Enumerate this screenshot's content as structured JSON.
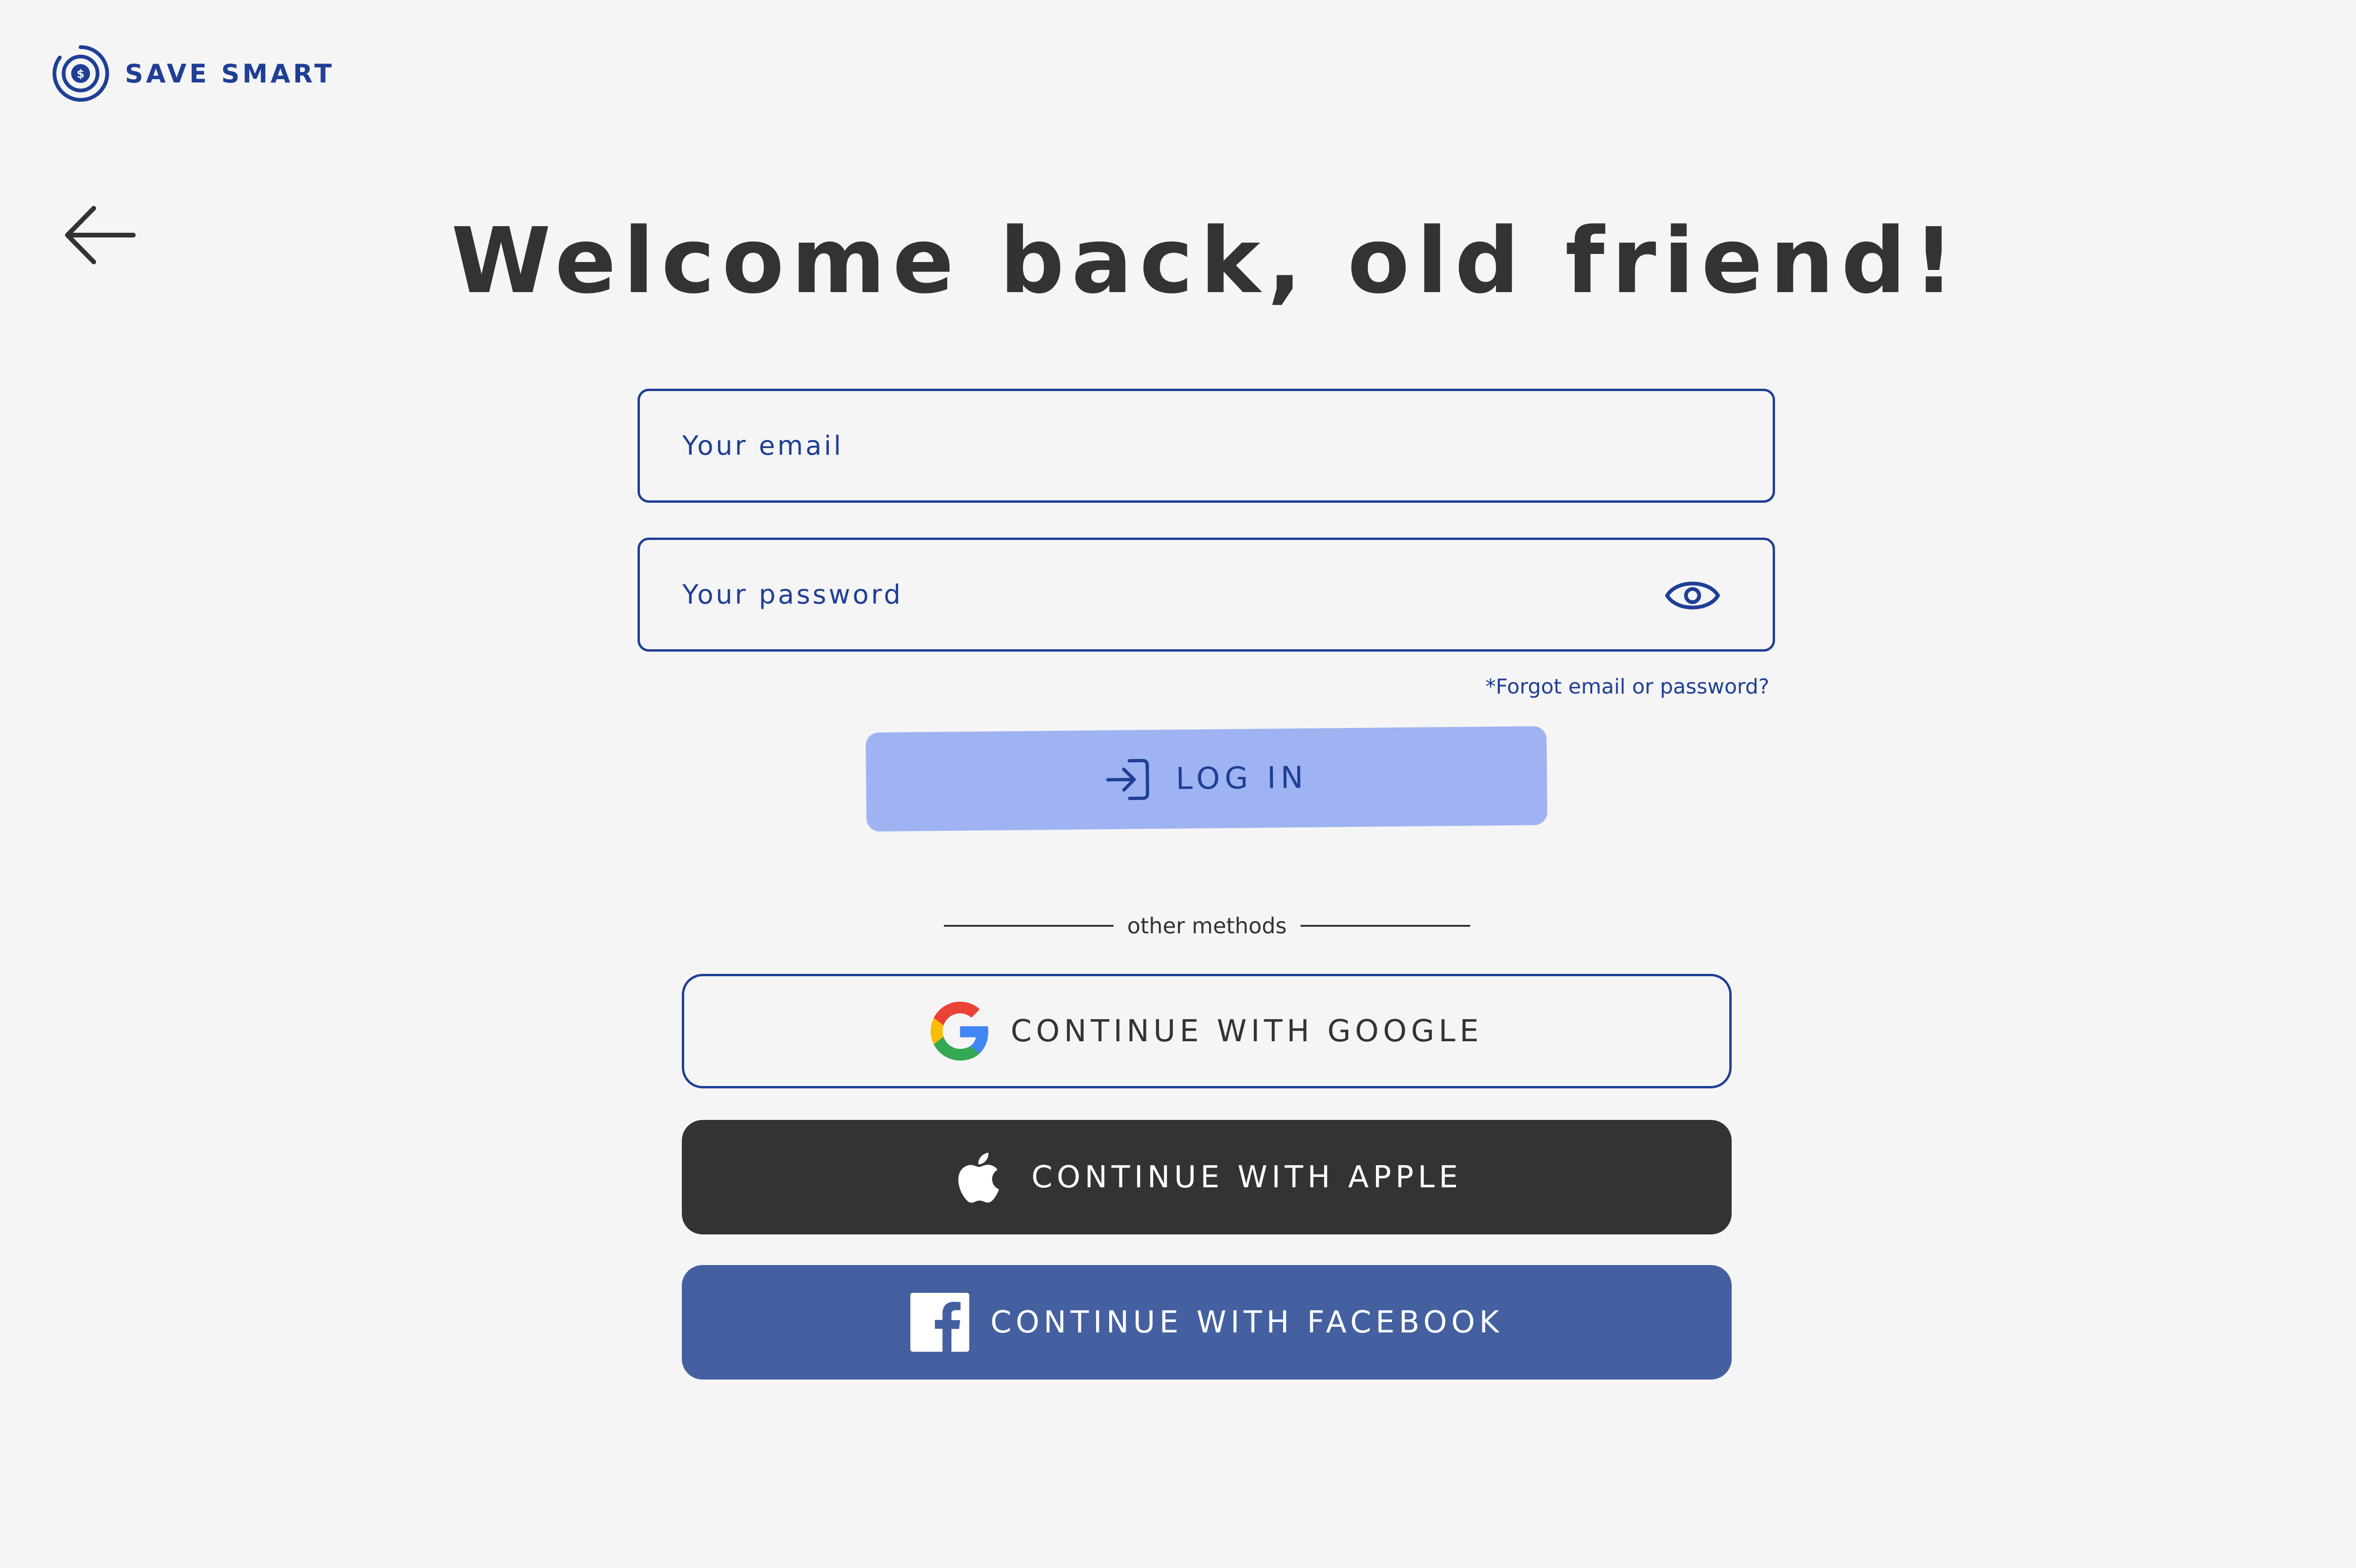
{
  "brand": {
    "name": "SAVE SMART",
    "logo_icon": "coin-target-icon",
    "color": "#1f3f96"
  },
  "nav": {
    "back_icon": "arrow-left-icon"
  },
  "title": "Welcome back, old friend!",
  "form": {
    "email": {
      "value": "",
      "placeholder": "Your email"
    },
    "password": {
      "value": "",
      "placeholder": "Your password",
      "toggle_icon": "eye-icon"
    },
    "forgot_link": "*Forgot email or password?",
    "login_button": {
      "label": "LOG IN",
      "icon": "login-arrow-icon",
      "color": "#9fb3f2"
    }
  },
  "divider": {
    "text": "other methods"
  },
  "social": {
    "google": {
      "label": "CONTINUE WITH GOOGLE",
      "icon": "google-icon"
    },
    "apple": {
      "label": "CONTINUE WITH APPLE",
      "icon": "apple-icon",
      "color": "#333333"
    },
    "facebook": {
      "label": "CONTINUE WITH FACEBOOK",
      "icon": "facebook-icon",
      "color": "#4460a1"
    }
  },
  "colors": {
    "background": "#f5f5f5",
    "text": "#333333",
    "accent": "#1f3f96"
  }
}
